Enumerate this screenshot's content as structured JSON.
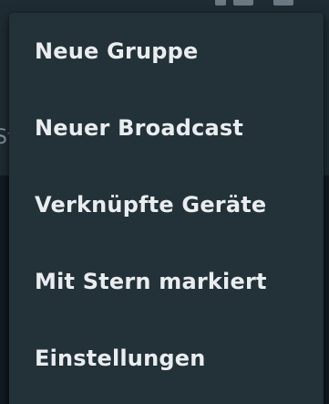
{
  "background": {
    "peek_text": "St"
  },
  "menu": {
    "items": [
      {
        "label": "Neue Gruppe"
      },
      {
        "label": "Neuer Broadcast"
      },
      {
        "label": "Verknüpfte Geräte"
      },
      {
        "label": "Mit Stern markiert"
      },
      {
        "label": "Einstellungen"
      }
    ]
  },
  "colors": {
    "menu_background": "#233138",
    "menu_text": "#e9edef",
    "app_header": "#1f2c33",
    "app_body": "#111b21"
  }
}
